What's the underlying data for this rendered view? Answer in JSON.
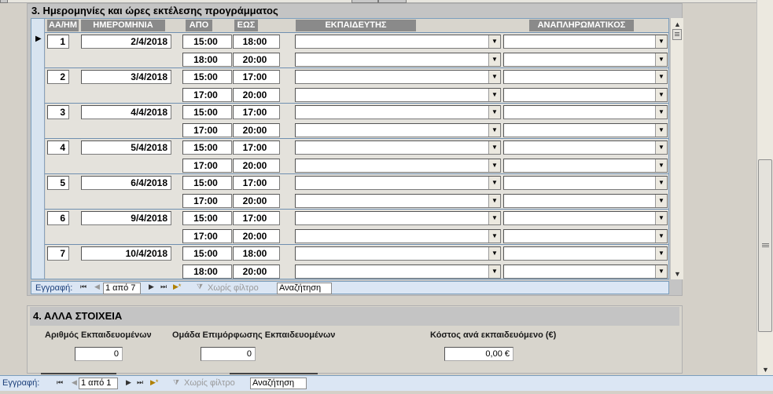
{
  "section3": {
    "title": "3. Ημερομηνίες και ώρες εκτέλεσης προγράμματος",
    "headers": {
      "aa": "ΑΑ/ΗΜ",
      "date": "ΗΜΕΡΟΜΗΝΙΑ",
      "from": "ΑΠΟ",
      "to": "ΕΩΣ",
      "trainer": "ΕΚΠΑΙΔΕΥΤΗΣ",
      "substitute": "ΑΝΑΠΛΗΡΩΜΑΤΙΚΟΣ"
    },
    "records": [
      {
        "aa": "1",
        "date": "2/4/2018",
        "rows": [
          {
            "from": "15:00",
            "to": "18:00"
          },
          {
            "from": "18:00",
            "to": "20:00"
          }
        ]
      },
      {
        "aa": "2",
        "date": "3/4/2018",
        "rows": [
          {
            "from": "15:00",
            "to": "17:00"
          },
          {
            "from": "17:00",
            "to": "20:00"
          }
        ]
      },
      {
        "aa": "3",
        "date": "4/4/2018",
        "rows": [
          {
            "from": "15:00",
            "to": "17:00"
          },
          {
            "from": "17:00",
            "to": "20:00"
          }
        ]
      },
      {
        "aa": "4",
        "date": "5/4/2018",
        "rows": [
          {
            "from": "15:00",
            "to": "17:00"
          },
          {
            "from": "17:00",
            "to": "20:00"
          }
        ]
      },
      {
        "aa": "5",
        "date": "6/4/2018",
        "rows": [
          {
            "from": "15:00",
            "to": "17:00"
          },
          {
            "from": "17:00",
            "to": "20:00"
          }
        ]
      },
      {
        "aa": "6",
        "date": "9/4/2018",
        "rows": [
          {
            "from": "15:00",
            "to": "17:00"
          },
          {
            "from": "17:00",
            "to": "20:00"
          }
        ]
      },
      {
        "aa": "7",
        "date": "10/4/2018",
        "rows": [
          {
            "from": "15:00",
            "to": "18:00"
          },
          {
            "from": "18:00",
            "to": "20:00"
          }
        ]
      }
    ],
    "nav": {
      "label": "Εγγραφή:",
      "position": "1 από 7",
      "filter": "Χωρίς φίλτρο",
      "search": "Αναζήτηση"
    }
  },
  "section4": {
    "title": "4. ΑΛΛΑ ΣΤΟΙΧΕΙΑ",
    "trainees_label": "Αριθμός Εκπαιδευομένων",
    "trainees_value": "0",
    "group_label": "Ομάδα  Επιμόρφωσης Εκπαιδευομένων",
    "group_value": "0",
    "cost_label": "Κόστος ανά εκπαιδευόμενο (€)",
    "cost_value": "0,00 €"
  },
  "main_nav": {
    "label": "Εγγραφή:",
    "position": "1 από 1",
    "filter": "Χωρίς φίλτρο",
    "search": "Αναζήτηση"
  },
  "icons": {
    "first": "⏮",
    "prev": "◀",
    "next": "▶",
    "last": "⏭",
    "new": "▶*",
    "filter": "funnel-icon"
  }
}
